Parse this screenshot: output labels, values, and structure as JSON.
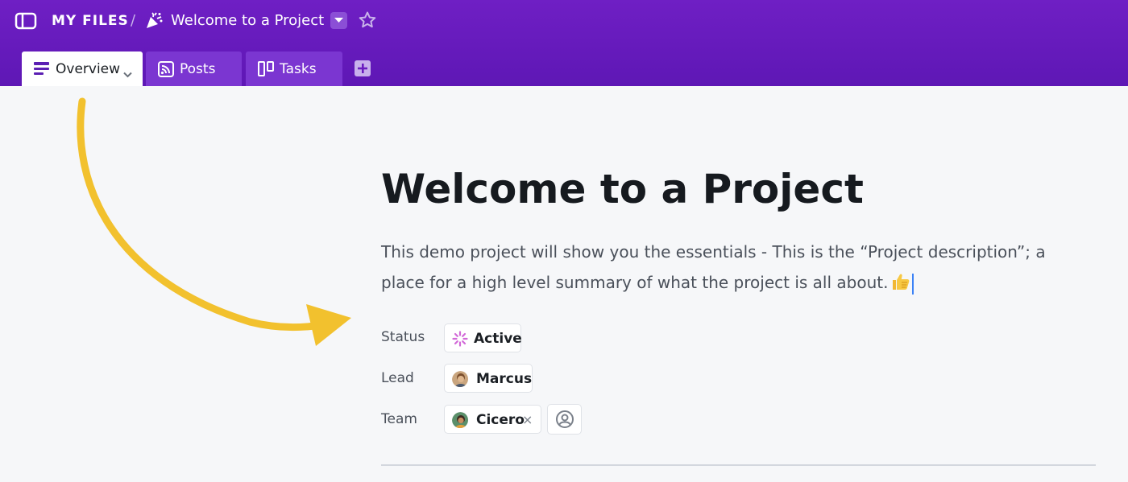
{
  "breadcrumb": {
    "root": "MY FILES",
    "separator": "/",
    "project_title": "Welcome to a Project"
  },
  "tabs": [
    {
      "label": "Overview",
      "icon": "overview-lines-icon",
      "active": true
    },
    {
      "label": "Posts",
      "icon": "rss-feed-icon",
      "active": false
    },
    {
      "label": "Tasks",
      "icon": "kanban-board-icon",
      "active": false
    }
  ],
  "main": {
    "title": "Welcome to a Project",
    "description": "This demo project will show you the essentials - This is the “Project description”; a place for a high level summary of what the project is all about."
  },
  "properties": {
    "status": {
      "label": "Status",
      "value": "Active"
    },
    "lead": {
      "label": "Lead",
      "value": "Marcus"
    },
    "team": {
      "label": "Team",
      "member": "Cicero",
      "remove_symbol": "×"
    }
  },
  "colors": {
    "header": "#6f1fc4",
    "inactive_tab": "#7b36d1",
    "arrow": "#f2c12e",
    "status_spinner": "#d26ad8",
    "caret": "#3b82f6"
  }
}
